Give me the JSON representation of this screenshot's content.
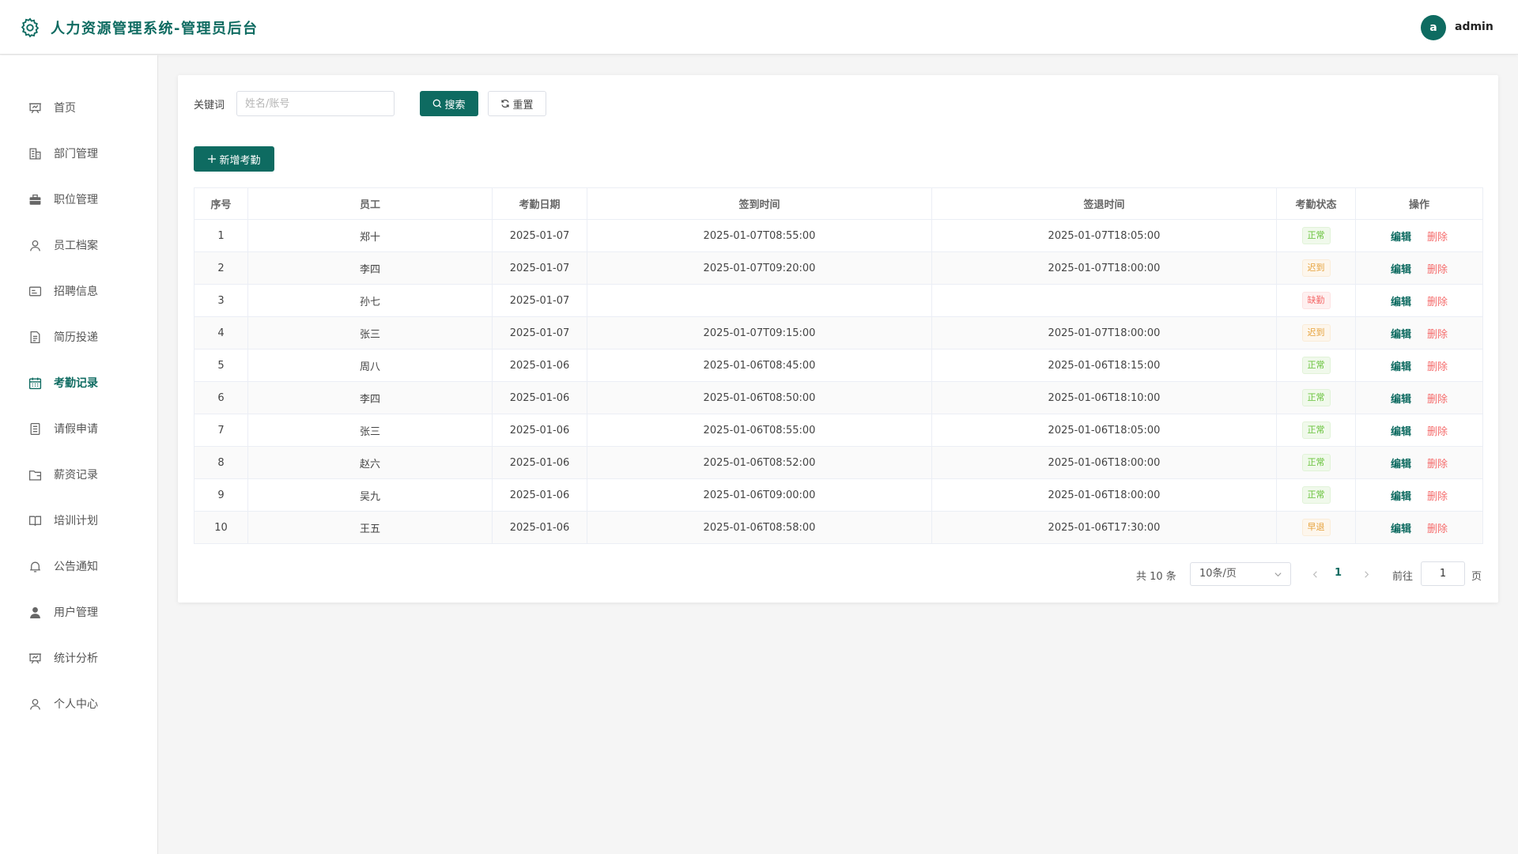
{
  "header": {
    "app_title": "人力资源管理系统-管理员后台",
    "avatar_letter": "a",
    "username": "admin"
  },
  "sidebar": {
    "items": [
      {
        "label": "首页",
        "icon": "presentation-icon",
        "active": false
      },
      {
        "label": "部门管理",
        "icon": "building-icon",
        "active": false
      },
      {
        "label": "职位管理",
        "icon": "briefcase-icon",
        "active": false
      },
      {
        "label": "员工档案",
        "icon": "user-icon",
        "active": false
      },
      {
        "label": "招聘信息",
        "icon": "id-card-icon",
        "active": false
      },
      {
        "label": "简历投递",
        "icon": "document-icon",
        "active": false
      },
      {
        "label": "考勤记录",
        "icon": "calendar-icon",
        "active": true
      },
      {
        "label": "请假申请",
        "icon": "form-icon",
        "active": false
      },
      {
        "label": "薪资记录",
        "icon": "wallet-icon",
        "active": false
      },
      {
        "label": "培训计划",
        "icon": "book-icon",
        "active": false
      },
      {
        "label": "公告通知",
        "icon": "bell-icon",
        "active": false
      },
      {
        "label": "用户管理",
        "icon": "user-filled-icon",
        "active": false
      },
      {
        "label": "统计分析",
        "icon": "chart-board-icon",
        "active": false
      },
      {
        "label": "个人中心",
        "icon": "user-icon",
        "active": false
      }
    ]
  },
  "search": {
    "label": "关键词",
    "placeholder": "姓名/账号",
    "search_label": "搜索",
    "reset_label": "重置"
  },
  "toolbar": {
    "add_label": "新增考勤"
  },
  "table": {
    "columns": [
      "序号",
      "员工",
      "考勤日期",
      "签到时间",
      "签退时间",
      "考勤状态",
      "操作"
    ],
    "edit_label": "编辑",
    "delete_label": "删除",
    "rows": [
      {
        "index": "1",
        "employee": "郑十",
        "date": "2025-01-07",
        "sign_in": "2025-01-07T08:55:00",
        "sign_out": "2025-01-07T18:05:00",
        "status": "正常",
        "status_type": "ok"
      },
      {
        "index": "2",
        "employee": "李四",
        "date": "2025-01-07",
        "sign_in": "2025-01-07T09:20:00",
        "sign_out": "2025-01-07T18:00:00",
        "status": "迟到",
        "status_type": "late"
      },
      {
        "index": "3",
        "employee": "孙七",
        "date": "2025-01-07",
        "sign_in": "",
        "sign_out": "",
        "status": "缺勤",
        "status_type": "abs"
      },
      {
        "index": "4",
        "employee": "张三",
        "date": "2025-01-07",
        "sign_in": "2025-01-07T09:15:00",
        "sign_out": "2025-01-07T18:00:00",
        "status": "迟到",
        "status_type": "late"
      },
      {
        "index": "5",
        "employee": "周八",
        "date": "2025-01-06",
        "sign_in": "2025-01-06T08:45:00",
        "sign_out": "2025-01-06T18:15:00",
        "status": "正常",
        "status_type": "ok"
      },
      {
        "index": "6",
        "employee": "李四",
        "date": "2025-01-06",
        "sign_in": "2025-01-06T08:50:00",
        "sign_out": "2025-01-06T18:10:00",
        "status": "正常",
        "status_type": "ok"
      },
      {
        "index": "7",
        "employee": "张三",
        "date": "2025-01-06",
        "sign_in": "2025-01-06T08:55:00",
        "sign_out": "2025-01-06T18:05:00",
        "status": "正常",
        "status_type": "ok"
      },
      {
        "index": "8",
        "employee": "赵六",
        "date": "2025-01-06",
        "sign_in": "2025-01-06T08:52:00",
        "sign_out": "2025-01-06T18:00:00",
        "status": "正常",
        "status_type": "ok"
      },
      {
        "index": "9",
        "employee": "吴九",
        "date": "2025-01-06",
        "sign_in": "2025-01-06T09:00:00",
        "sign_out": "2025-01-06T18:00:00",
        "status": "正常",
        "status_type": "ok"
      },
      {
        "index": "10",
        "employee": "王五",
        "date": "2025-01-06",
        "sign_in": "2025-01-06T08:58:00",
        "sign_out": "2025-01-06T17:30:00",
        "status": "早退",
        "status_type": "late"
      }
    ]
  },
  "pagination": {
    "total_text": "共 10 条",
    "page_size": "10条/页",
    "current_page": "1",
    "goto_label": "前往",
    "goto_value": "1",
    "page_suffix": "页"
  },
  "colors": {
    "primary": "#0e6b61",
    "danger": "#f56c6c",
    "success": "#67c23a",
    "warning": "#e6a23c"
  }
}
